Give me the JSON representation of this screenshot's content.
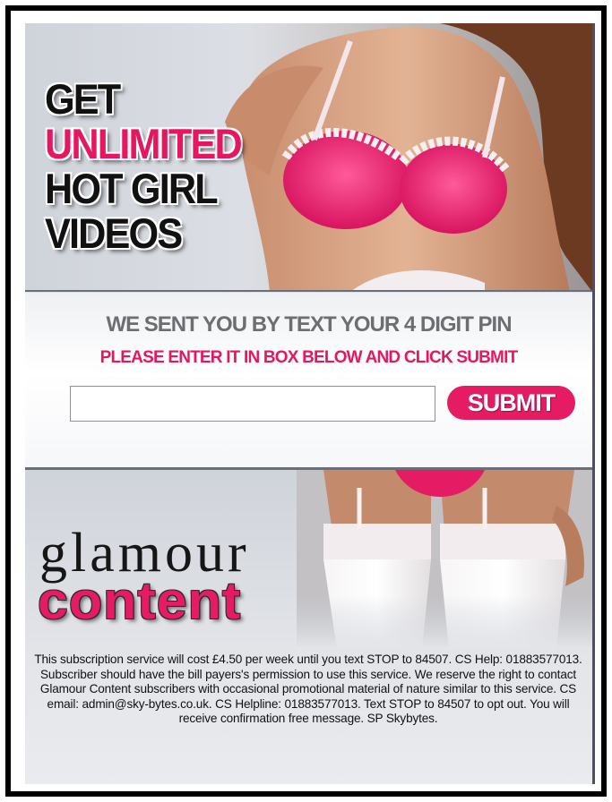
{
  "hero": {
    "headline_line1": "GET",
    "headline_line2": "UNLIMITED",
    "headline_line3": "HOT GIRL",
    "headline_line4": "VIDEOS"
  },
  "pin_form": {
    "instruction": "WE SENT YOU BY TEXT YOUR 4 DIGIT PIN",
    "sub_instruction": "PLEASE ENTER IT IN BOX BELOW AND CLICK SUBMIT",
    "pin_value": "",
    "submit_label": "SUBMIT"
  },
  "logo": {
    "line1": "glamour",
    "line2": "content"
  },
  "terms_text": "This subscription service will cost £4.50 per week until you text STOP to 84507. CS Help: 01883577013. Subscriber should have the bill payers's permission to use this service.  We reserve the right to contact Glamour Content subscribers with occasional promotional material of nature similar to this service. CS email: admin@sky-bytes.co.uk. CS Helpline: 01883577013. Text STOP to 84507 to opt out. You will receive confirmation free message. SP Skybytes.",
  "colors": {
    "accent_pink": "#e51b63",
    "frame": "#000000",
    "instruction_gray": "#6d6e72"
  }
}
